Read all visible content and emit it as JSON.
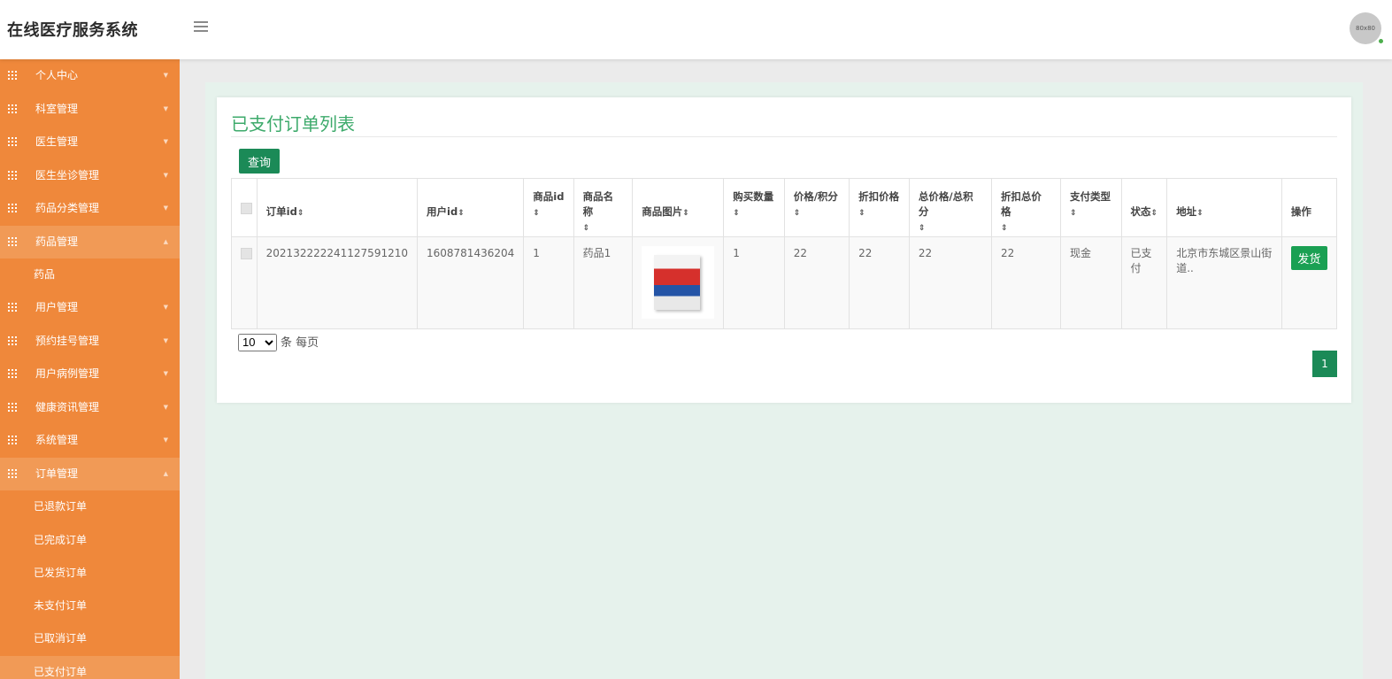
{
  "header": {
    "app_title": "在线医疗服务系统",
    "avatar_text": "80x80"
  },
  "sidebar": {
    "items": [
      {
        "label": "个人中心",
        "open": false
      },
      {
        "label": "科室管理",
        "open": false
      },
      {
        "label": "医生管理",
        "open": false
      },
      {
        "label": "医生坐诊管理",
        "open": false
      },
      {
        "label": "药品分类管理",
        "open": false
      },
      {
        "label": "药品管理",
        "open": true,
        "children": [
          "药品"
        ]
      },
      {
        "label": "用户管理",
        "open": false
      },
      {
        "label": "预约挂号管理",
        "open": false
      },
      {
        "label": "用户病例管理",
        "open": false
      },
      {
        "label": "健康资讯管理",
        "open": false
      },
      {
        "label": "系统管理",
        "open": false
      },
      {
        "label": "订单管理",
        "open": true,
        "children": [
          "已退款订单",
          "已完成订单",
          "已发货订单",
          "未支付订单",
          "已取消订单",
          "已支付订单"
        ]
      }
    ],
    "active_sub": "已支付订单"
  },
  "panel": {
    "title": "已支付订单列表",
    "query_label": "查询"
  },
  "table": {
    "columns": [
      {
        "label": "订单id",
        "sort": "⇕"
      },
      {
        "label": "用户id",
        "sort": "⇕"
      },
      {
        "label": "商品id",
        "sort": "⇕"
      },
      {
        "label": "商品名称",
        "sort": "⇕"
      },
      {
        "label": "商品图片",
        "sort": "⇕"
      },
      {
        "label": "购买数量",
        "sort": "⇕"
      },
      {
        "label": "价格/积分",
        "sort": "⇕"
      },
      {
        "label": "折扣价格",
        "sort": "⇕"
      },
      {
        "label": "总价格/总积分",
        "sort": "⇕"
      },
      {
        "label": "折扣总价格",
        "sort": "⇕"
      },
      {
        "label": "支付类型",
        "sort": "⇕"
      },
      {
        "label": "状态",
        "sort": "⇕"
      },
      {
        "label": "地址",
        "sort": "⇕"
      },
      {
        "label": "操作",
        "sort": ""
      }
    ],
    "rows": [
      {
        "order_id": "202132222241127591210",
        "user_id": "1608781436204",
        "product_id": "1",
        "product_name": "药品1",
        "quantity": "1",
        "price": "22",
        "discount_price": "22",
        "total_price": "22",
        "discount_total": "22",
        "payment_type": "现金",
        "status": "已支付",
        "address": "北京市东城区景山街道..",
        "action_label": "发货"
      }
    ]
  },
  "pagination": {
    "page_size": "10",
    "page_size_suffix": "条 每页",
    "current_page": "1"
  },
  "colors": {
    "sidebar": "#ef883b",
    "accent_green": "#1b8a57",
    "title_green": "#3daa6b"
  }
}
